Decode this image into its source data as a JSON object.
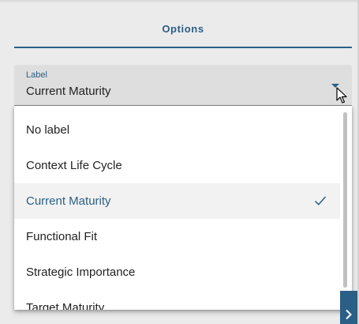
{
  "panel": {
    "title": "Options"
  },
  "select": {
    "label": "Label",
    "value": "Current Maturity"
  },
  "dropdown": {
    "options": [
      {
        "label": "No label",
        "selected": false
      },
      {
        "label": "Context Life Cycle",
        "selected": false
      },
      {
        "label": "Current Maturity",
        "selected": true
      },
      {
        "label": "Functional Fit",
        "selected": false
      },
      {
        "label": "Strategic Importance",
        "selected": false
      },
      {
        "label": "Target Maturity",
        "selected": false
      }
    ]
  },
  "icons": {
    "dropdown_arrow": "caret-down-icon",
    "selected_mark": "checkmark-icon",
    "pointer": "mouse-cursor-icon",
    "corner": "chevron-right-icon"
  },
  "colors": {
    "accent": "#2b5f85",
    "background": "#ebebeb",
    "field_background": "#dedede",
    "selected_row": "#f2f2f2",
    "text": "#222222"
  }
}
